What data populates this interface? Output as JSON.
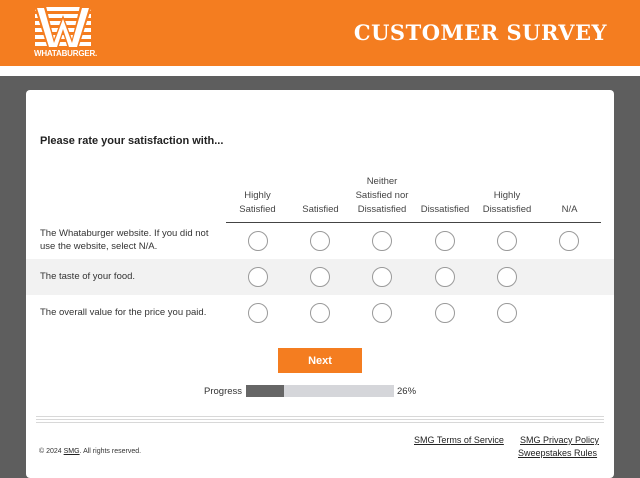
{
  "header": {
    "brand": "WHATABURGER.",
    "title": "CUSTOMER SURVEY",
    "accent_color": "#f47d20",
    "logo_icon": "whataburger-w-logo"
  },
  "survey": {
    "question": "Please rate your satisfaction with...",
    "columns": [
      "Highly Satisfied",
      "Satisfied",
      "Neither Satisfied nor Dissatisfied",
      "Dissatisfied",
      "Highly Dissatisfied",
      "N/A"
    ],
    "rows": [
      {
        "label": "The Whataburger website. If you did not use the website, select N/A.",
        "has_na": true
      },
      {
        "label": "The taste of your food.",
        "has_na": false
      },
      {
        "label": "The overall value for the price you paid.",
        "has_na": false
      }
    ],
    "next_label": "Next"
  },
  "progress": {
    "label": "Progress",
    "percent": 26,
    "percent_text": "26%"
  },
  "footer": {
    "copyright_prefix": "© 2024 ",
    "copyright_link": "SMG",
    "copyright_suffix": ". All rights reserved.",
    "links": {
      "terms": "SMG Terms of Service",
      "privacy": "SMG Privacy Policy",
      "sweepstakes": "Sweepstakes Rules"
    }
  }
}
